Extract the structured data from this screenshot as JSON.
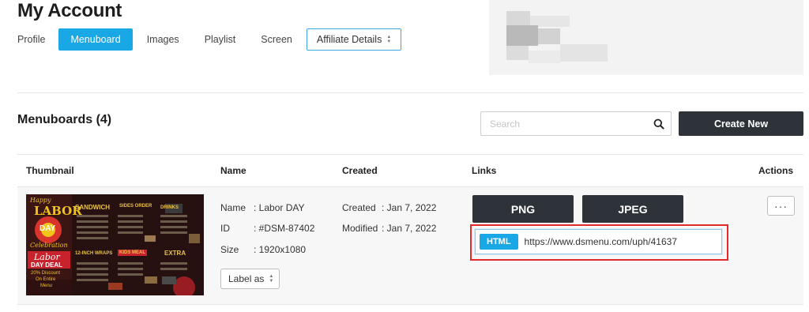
{
  "page": {
    "title": "My Account"
  },
  "tabs": [
    {
      "label": "Profile"
    },
    {
      "label": "Menuboard",
      "active": true
    },
    {
      "label": "Images"
    },
    {
      "label": "Playlist"
    },
    {
      "label": "Screen"
    }
  ],
  "tab_select": {
    "label": "Affiliate Details"
  },
  "section": {
    "title": "Menuboards (4)"
  },
  "search": {
    "placeholder": "Search",
    "value": ""
  },
  "create_button": {
    "label": "Create New"
  },
  "table": {
    "headers": {
      "thumbnail": "Thumbnail",
      "name": "Name",
      "created": "Created",
      "links": "Links",
      "actions": "Actions"
    },
    "rows": [
      {
        "thumbnail": {
          "happy": "Happy",
          "labor": "LABOR",
          "day": "DAY",
          "celebration": "Celebration",
          "sandwich": "SANDWICH",
          "sides_order": "SIDES ORDER",
          "drinks": "DRINKS",
          "wraps": "12-INCH WRAPS",
          "kids_meal": "KIDS MEAL",
          "extra": "EXTRA",
          "deal_labor": "Labor",
          "deal_day": "DAY DEAL",
          "discount": "20% Discount",
          "on_entire": "On Entire",
          "menu": "Menu"
        },
        "name_label": "Name",
        "name_value": ": Labor DAY",
        "id_label": "ID",
        "id_value": ": #DSM-87402",
        "size_label": "Size",
        "size_value": ": 1920x1080",
        "created_label": "Created",
        "created_value": ": Jan 7, 2022",
        "modified_label": "Modified",
        "modified_value": ": Jan 7, 2022",
        "label_as": "Label as",
        "png_label": "PNG",
        "jpeg_label": "JPEG",
        "html_badge": "HTML",
        "html_url": "https://www.dsmenu.com/uph/41637",
        "more_label": "···"
      }
    ]
  },
  "colors": {
    "accent": "#1aa7e6",
    "dark_button": "#2d3338",
    "highlight": "#e32a2a",
    "row_bg": "#f7f7f7"
  },
  "icons": [
    "search-icon",
    "updown-icon",
    "more-icon"
  ]
}
